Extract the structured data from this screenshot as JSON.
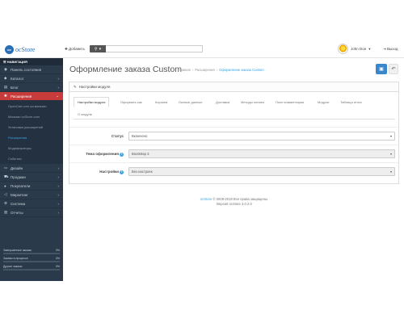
{
  "header": {
    "logo_text": "ocStore",
    "add_label": "Добавить",
    "user_name": "John Doe",
    "logout_label": "Выход"
  },
  "sidebar": {
    "heading": "НАВИГАЦИЯ",
    "items": [
      {
        "label": "Панель состояния",
        "icon": "dashboard-icon"
      },
      {
        "label": "Каталог",
        "icon": "tag-icon"
      },
      {
        "label": "Блог",
        "icon": "book-icon"
      },
      {
        "label": "Расширения",
        "icon": "puzzle-icon"
      }
    ],
    "subitems": [
      "OpenCart.com.ua магазин",
      "Магазин ocStore.com",
      "Установка расширений",
      "Расширения",
      "Модификаторы",
      "События"
    ],
    "items2": [
      {
        "label": "Дизайн",
        "icon": "monitor-icon"
      },
      {
        "label": "Продажи",
        "icon": "cart-icon"
      },
      {
        "label": "Покупатели",
        "icon": "user-icon"
      },
      {
        "label": "Маркетинг",
        "icon": "share-icon"
      },
      {
        "label": "Система",
        "icon": "gear-icon"
      },
      {
        "label": "Отчеты",
        "icon": "bar-chart-icon"
      }
    ],
    "stats": [
      {
        "label": "Завершенные заказы",
        "value": "0%"
      },
      {
        "label": "Заказы в процессе",
        "value": "0%"
      },
      {
        "label": "Другие заказы",
        "value": "0%"
      }
    ]
  },
  "page": {
    "title": "Оформление заказа Custom",
    "breadcrumb": [
      "Главная",
      "Расширения",
      "Оформление заказа Custom"
    ]
  },
  "panel": {
    "heading": "Настройки модуля",
    "tabs": [
      "Настройки модуля",
      "Оформить как",
      "Корзина",
      "Личные данные",
      "Доставка",
      "Методы оплаты",
      "Поле комментария",
      "Модули",
      "Таблица итога",
      "О модуле"
    ],
    "fields": [
      {
        "label": "Статус",
        "value": "Включено",
        "help": false
      },
      {
        "label": "Тема оформления",
        "value": "Bootstrap 3",
        "help": true
      },
      {
        "label": "Настройки",
        "value": "Без настроек",
        "help": true
      }
    ]
  },
  "footer": {
    "link": "ocStore",
    "copyright": "© 2009-2019 Все права защищены.",
    "version": "Версия ocStore 3.0.2.0"
  }
}
